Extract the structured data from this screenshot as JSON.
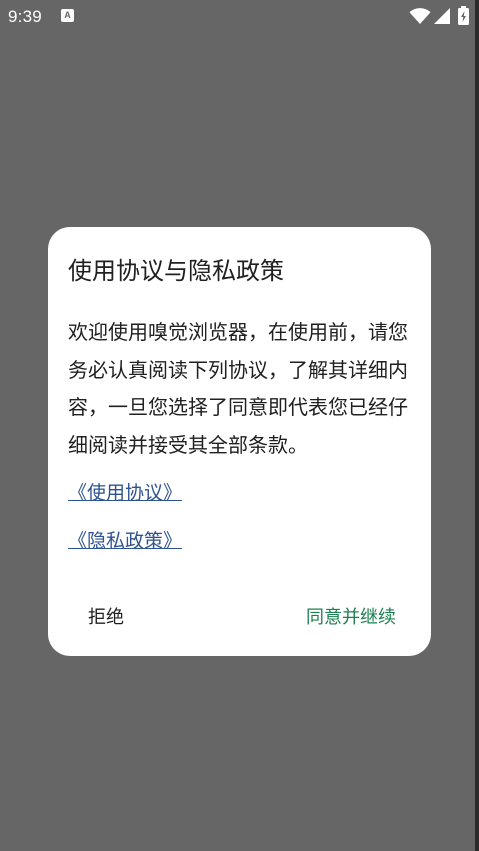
{
  "status_bar": {
    "time": "9:39",
    "notification_icon": "a-icon",
    "icons": [
      "wifi-icon",
      "signal-icon",
      "battery-charging-icon"
    ]
  },
  "dialog": {
    "title": "使用协议与隐私政策",
    "message": "欢迎使用嗅觉浏览器，在使用前，请您务必认真阅读下列协议，了解其详细内容，一旦您选择了同意即代表您已经仔细阅读并接受其全部条款。",
    "links": [
      {
        "label": "《使用协议》"
      },
      {
        "label": "《隐私政策》"
      }
    ],
    "buttons": {
      "reject": "拒绝",
      "agree": "同意并继续"
    }
  },
  "colors": {
    "scrim": "#666666",
    "dialog_background": "#ffffff",
    "text": "#202020",
    "link": "#2e5391",
    "accent": "#1c7f4f"
  }
}
